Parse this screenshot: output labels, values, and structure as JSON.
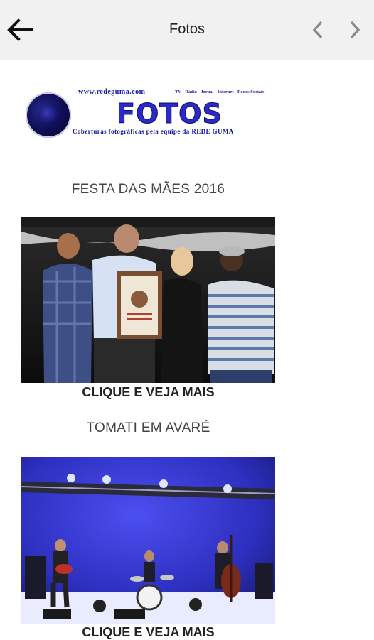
{
  "header": {
    "title": "Fotos",
    "icons": {
      "back": "arrow-left-icon",
      "prev": "chevron-left-icon",
      "next": "chevron-right-icon"
    }
  },
  "logo": {
    "url": "www.redeguma.com",
    "media": "TV - Rádio - Jornal - Internet - Redes Sociais",
    "word": "FOTOS",
    "tagline": "Coberturas fotográficas pela equipe da REDE GUMA"
  },
  "albums": [
    {
      "title": "FESTA DAS MÃES 2016",
      "link": "CLIQUE E VEJA MAIS"
    },
    {
      "title": "TOMATI EM AVARÉ",
      "link": "CLIQUE E VEJA MAIS"
    }
  ]
}
